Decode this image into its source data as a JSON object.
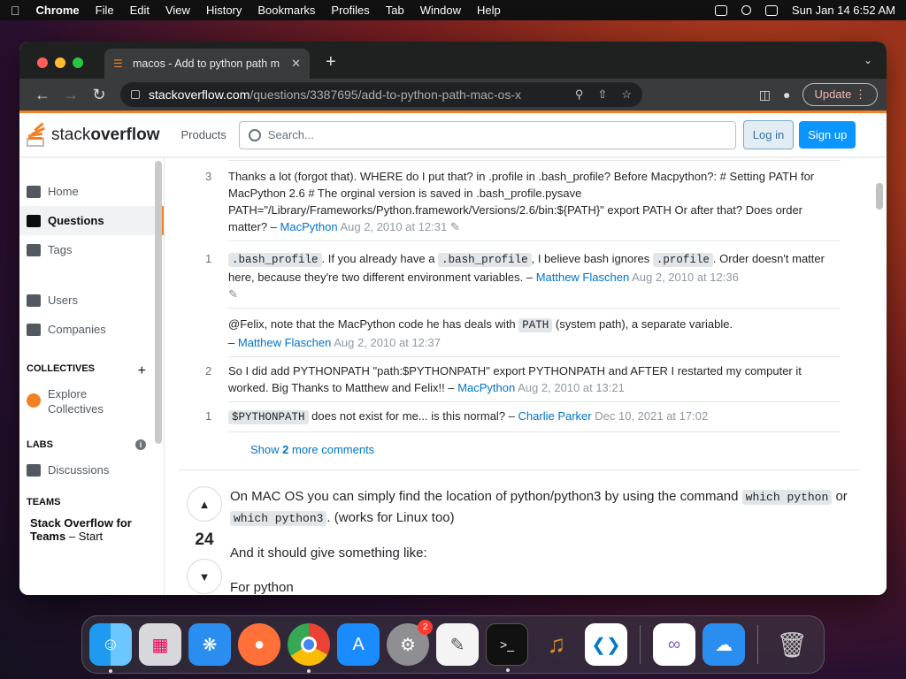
{
  "menubar": {
    "app": "Chrome",
    "items": [
      "File",
      "Edit",
      "View",
      "History",
      "Bookmarks",
      "Profiles",
      "Tab",
      "Window",
      "Help"
    ],
    "datetime": "Sun Jan 14  6:52 AM"
  },
  "browser": {
    "tab_title": "macos - Add to python path m",
    "url_host": "stackoverflow.com",
    "url_path": "/questions/3387695/add-to-python-path-mac-os-x",
    "update_label": "Update"
  },
  "so_header": {
    "logo_light": "stack",
    "logo_bold": "overflow",
    "products": "Products",
    "search_placeholder": "Search...",
    "login": "Log in",
    "signup": "Sign up"
  },
  "sidebar": {
    "items": [
      {
        "label": "Home",
        "icon": "home-icon"
      },
      {
        "label": "Questions",
        "icon": "questions-icon"
      },
      {
        "label": "Tags",
        "icon": "tag-icon"
      },
      {
        "label": "Users",
        "icon": "users-icon"
      },
      {
        "label": "Companies",
        "icon": "companies-icon"
      }
    ],
    "collectives_heading": "COLLECTIVES",
    "explore_line1": "Explore",
    "explore_line2": "Collectives",
    "labs_heading": "LABS",
    "discussions": "Discussions",
    "teams_heading": "TEAMS",
    "teams_title": "Stack Overflow for Teams",
    "teams_suffix": " – Start"
  },
  "comments": [
    {
      "score": "3",
      "text": "Thanks a lot (forgot that). WHERE do I put that? in .profile in .bash_profile? Before Macpython?: # Setting PATH for MacPython 2.6 # The orginal version is saved in .bash_profile.pysave PATH=\"/Library/Frameworks/Python.framework/Versions/2.6/bin:${PATH}\" export PATH Or after that? Does order matter? –",
      "user": "MacPython",
      "date": "Aug 2, 2010 at 12:31"
    },
    {
      "score": "1",
      "code1": ".bash_profile",
      "t1": ". If you already have a ",
      "code2": ".bash_profile",
      "t2": ", I believe bash ignores ",
      "code3": ".profile",
      "t3": ". Order doesn't matter here, because they're two different environment variables. –",
      "user": "Matthew Flaschen",
      "date": "Aug 2, 2010 at 12:36"
    },
    {
      "score": "",
      "t1": "@Felix, note that the MacPython code he has deals with ",
      "code1": "PATH",
      "t2": " (system path), a separate variable.",
      "t3": "–",
      "user": "Matthew Flaschen",
      "date": "Aug 2, 2010 at 12:37"
    },
    {
      "score": "2",
      "text": "So I did add PYTHONPATH \"path:$PYTHONPATH\" export PYTHONPATH and AFTER I restarted my computer it worked. Big Thanks to Matthew and Felix!! –",
      "user": "MacPython",
      "date": "Aug 2, 2010 at 13:21"
    },
    {
      "score": "1",
      "code1": "$PYTHONPATH",
      "t1": " does not exist for me... is this normal? –",
      "user": "Charlie Parker",
      "date": "Dec 10, 2021 at 17:02"
    }
  ],
  "show_more": {
    "prefix": "Show ",
    "count": "2",
    "suffix": " more comments"
  },
  "answer": {
    "votes": "24",
    "p1_a": "On MAC OS you can simply find the location of python/python3 by using the command ",
    "p1_code1": "which python",
    "p1_b": " or ",
    "p1_code2": "which python3",
    "p1_c": ". (works for Linux too)",
    "p2": "And it should give something like:",
    "p3": "For python"
  },
  "dock": {
    "apps": [
      "finder-icon",
      "launchpad-icon",
      "safari-icon",
      "firefox-icon",
      "chrome-icon",
      "app-store-icon",
      "system-settings-icon",
      "textedit-icon",
      "terminal-icon",
      "garageband-icon",
      "vscode-icon",
      "visual-studio-icon",
      "weather-icon",
      "trash-icon"
    ],
    "settings_badge": "2"
  }
}
